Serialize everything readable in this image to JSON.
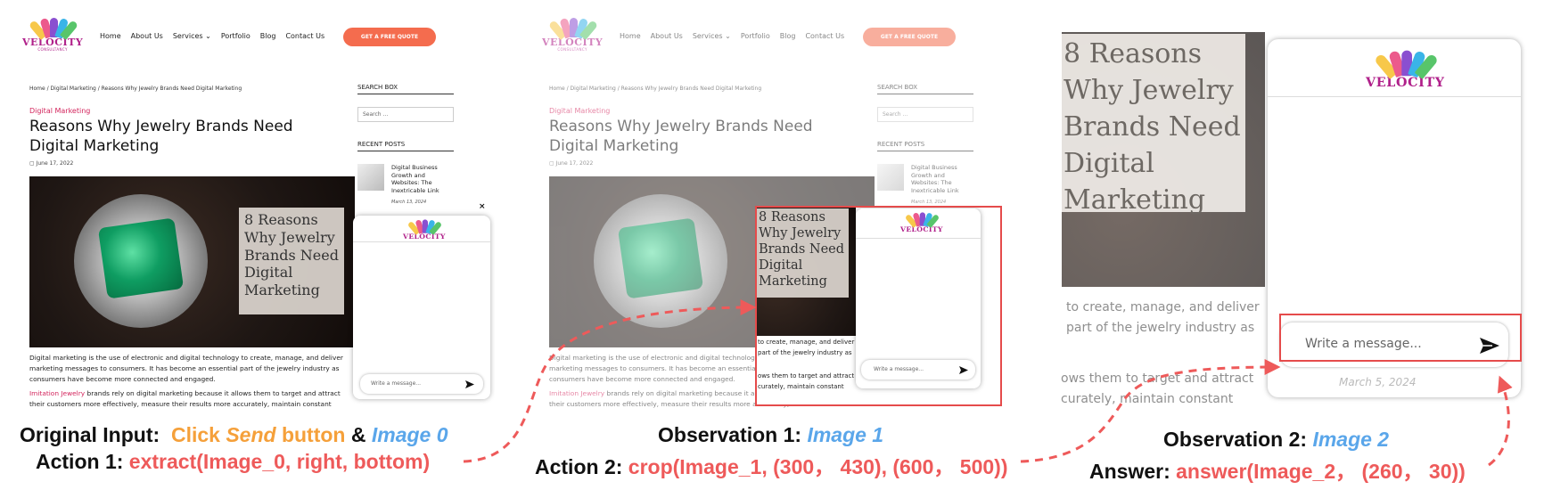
{
  "site": {
    "logo_word": "VELOCITY",
    "logo_sub": "CONSULTANCY",
    "nav": [
      "Home",
      "About Us",
      "Services",
      "Portfolio",
      "Blog",
      "Contact Us"
    ],
    "quote_button": "GET A FREE QUOTE",
    "breadcrumb": "Home / Digital Marketing / Reasons Why Jewelry Brands Need Digital Marketing",
    "category": "Digital Marketing",
    "title": "Reasons Why Jewelry Brands Need Digital Marketing",
    "date": "June 17, 2022",
    "overlay_text": "8 Reasons Why Jewelry Brands Need Digital Marketing",
    "paragraph1": "Digital marketing is the use of electronic and digital technology to create, manage, and deliver marketing messages to consumers. It has become an essential part of the jewelry industry as consumers have become more connected and engaged.",
    "paragraph2_link": "Imitation Jewelry",
    "paragraph2_rest": " brands rely on digital marketing because it allows them to target and attract their customers more effectively, measure their results more accurately, maintain constant",
    "search_heading": "SEARCH BOX",
    "search_placeholder": "Search ...",
    "recent_heading": "RECENT POSTS",
    "recent_post_title": "Digital Business Growth and Websites: The Inextricable Link",
    "recent_post_date": "March 13, 2024",
    "chat_placeholder": "Write a message...",
    "close_glyph": "×"
  },
  "crop": {
    "frag1": "to create, manage, and deliver",
    "frag2": "part of the jewelry industry as",
    "frag3": "ows them to target and attract",
    "frag4": "curately, maintain constant",
    "date_fragment": "March 5, 2024"
  },
  "captions": {
    "original_input_label": "Original Input",
    "original_input_action": "Click ",
    "send_word": "Send",
    "button_word": " button",
    "amp": " & ",
    "image0": "Image 0",
    "action1_label": "Action 1: ",
    "action1_value": "extract(Image_0, right, bottom)",
    "obs1_label": "Observation 1: ",
    "image1": "Image 1",
    "action2_label": "Action 2: ",
    "action2_value": "crop(Image_1, (300， 430), (600， 500))",
    "obs2_label": "Observation 2: ",
    "image2": "Image 2",
    "answer_label": "Answer: ",
    "answer_value": "answer(Image_2， (260， 30))"
  },
  "colors": {
    "accent_pink": "#d3245c",
    "quote_orange": "#f46c4e",
    "red_box": "#e54b4b",
    "caption_orange": "#f5a03a",
    "caption_blue": "#5aa6ea",
    "caption_red": "#ee5a5a"
  },
  "icons": [
    "logo-mark-icon",
    "chevron-down-icon",
    "calendar-icon",
    "send-icon",
    "close-icon",
    "dashed-arrow-icon"
  ]
}
